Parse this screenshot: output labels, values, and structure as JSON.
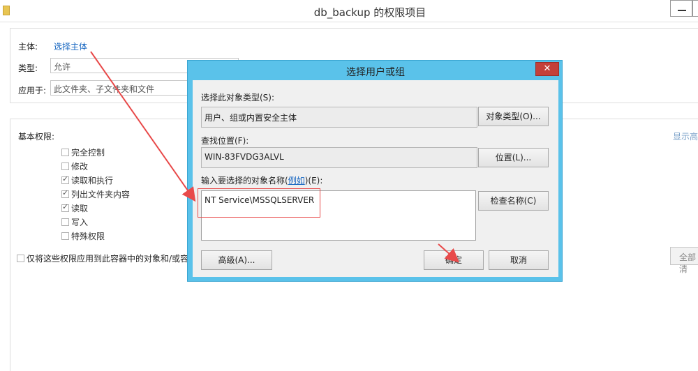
{
  "window": {
    "title": "db_backup 的权限项目"
  },
  "header": {
    "principal_label": "主体:",
    "principal_link": "选择主体",
    "type_label": "类型:",
    "type_value": "允许",
    "applies_label": "应用于:",
    "applies_value": "此文件夹、子文件夹和文件"
  },
  "permissions": {
    "title": "基本权限:",
    "items": [
      {
        "label": "完全控制",
        "checked": false
      },
      {
        "label": "修改",
        "checked": false
      },
      {
        "label": "读取和执行",
        "checked": true
      },
      {
        "label": "列出文件夹内容",
        "checked": true
      },
      {
        "label": "读取",
        "checked": true
      },
      {
        "label": "写入",
        "checked": false
      },
      {
        "label": "特殊权限",
        "checked": false
      }
    ],
    "apply_only_label": "仅将这些权限应用到此容器中的对象和/或容",
    "show_advanced": "显示高",
    "clear_all": "全部清"
  },
  "dialog": {
    "title": "选择用户或组",
    "close": "✕",
    "object_type_label": "选择此对象类型(S):",
    "object_type_value": "用户、组或内置安全主体",
    "object_type_button": "对象类型(O)...",
    "location_label": "查找位置(F):",
    "location_value": "WIN-83FVDG3ALVL",
    "location_button": "位置(L)...",
    "names_label_pre": "输入要选择的对象名称(",
    "names_label_link": "例如",
    "names_label_post": ")(E):",
    "names_value": "NT Service\\MSSQLSERVER",
    "check_names_button": "检查名称(C)",
    "advanced_button": "高级(A)...",
    "ok_button": "确定",
    "cancel_button": "取消"
  },
  "colors": {
    "dialog_frame": "#5ac2ea",
    "close_button": "#c4403a",
    "annotation": "#e84a4a",
    "link": "#1565c0"
  }
}
